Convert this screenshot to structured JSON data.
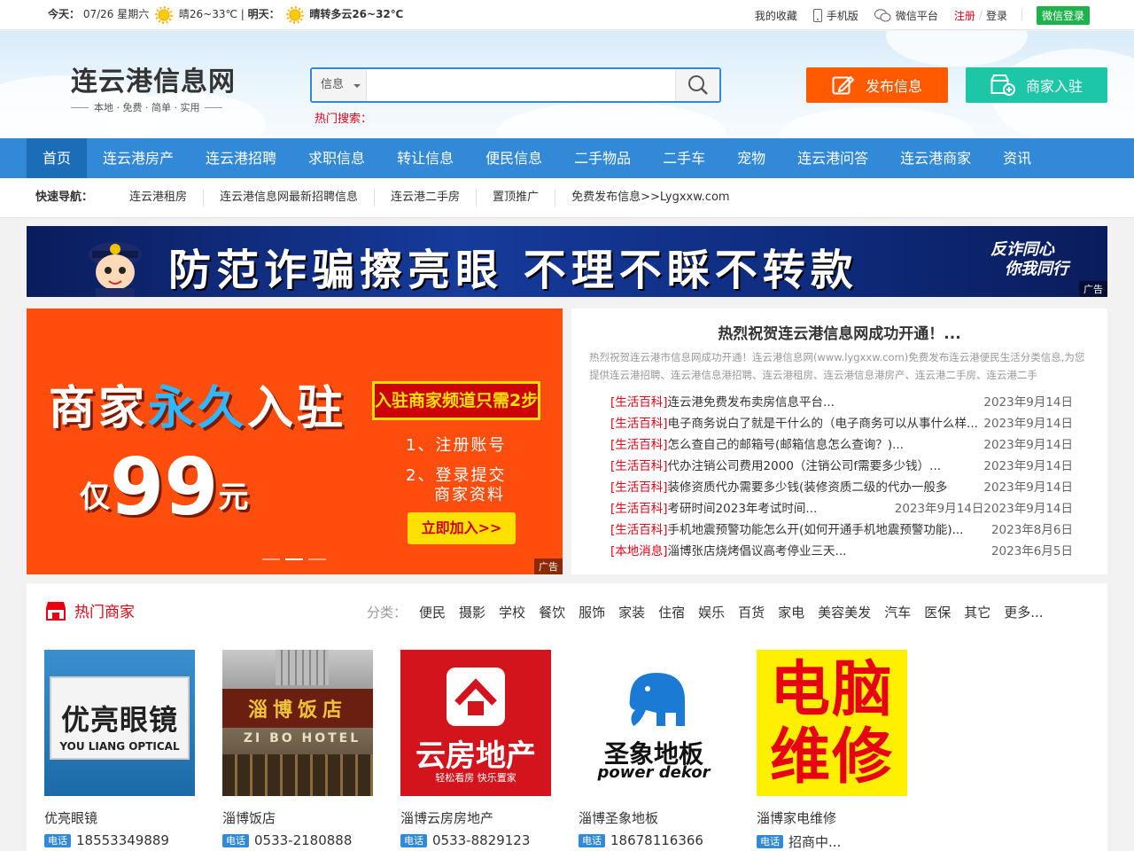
{
  "topbar": {
    "today_label": "今天：",
    "today_date": "07/26 星期六",
    "today_weather": "晴26~33℃ | ",
    "tomorrow_label": "明天：",
    "tomorrow_weather": "晴转多云26~32℃",
    "favorites": "我的收藏",
    "mobile": "手机版",
    "wechat_platform": "微信平台",
    "register": "注册",
    "login": "登录",
    "wechat_login": "微信登录"
  },
  "header": {
    "logo_title": "连云港信息网",
    "logo_slogan": "本地 · 免费 · 简单 · 实用",
    "search_type": "信息",
    "search_value": "",
    "hot_search_label": "热门搜索：",
    "publish_button": "发布信息",
    "merchant_join_button": "商家入驻"
  },
  "nav": {
    "items": [
      "首页",
      "连云港房产",
      "连云港招聘",
      "求职信息",
      "转让信息",
      "便民信息",
      "二手物品",
      "二手车",
      "宠物",
      "连云港问答",
      "连云港商家",
      "资讯"
    ]
  },
  "quicknav": {
    "label": "快速导航：",
    "items": [
      "连云港租房",
      "连云港信息网最新招聘信息",
      "连云港二手房",
      "置顶推广",
      "免费发布信息>>Lygxxw.com"
    ]
  },
  "banner": {
    "text": "防范诈骗擦亮眼  不理不睬不转款",
    "badge_line1": "反诈同心",
    "badge_line2": "你我同行",
    "ad_tag": "广告"
  },
  "big_ad": {
    "line1_a": "商家",
    "line1_b": "永久",
    "line1_c": "入驻",
    "line2_a": "仅",
    "line2_b": "99",
    "line2_c": "元",
    "box": "入驻商家频道只需2步",
    "step1": "1、注册账号",
    "step2a": "2、登录提交",
    "step2b": "商家资料",
    "join": "立即加入>>",
    "ad_tag": "广告"
  },
  "news": {
    "headline": "热烈祝贺连云港信息网成功开通！...",
    "intro": "热烈祝贺连云港市信息网成功开通！连云港信息网(www.lygxxw.com)免费发布连云港便民生活分类信息,为您提供连云港招聘、连云港信息港招聘、连云港租房、连云港信息港房产、连云港二手房、连云港二手",
    "items": [
      {
        "cat": "[生活百科]",
        "title": "连云港免费发布卖房信息平台...",
        "date": "2023年9月14日"
      },
      {
        "cat": "[生活百科]",
        "title": "电子商务说白了就是干什么的（电子商务可以从事什么样...",
        "date": "2023年9月14日"
      },
      {
        "cat": "[生活百科]",
        "title": "怎么查自己的邮箱号(邮箱信息怎么查询？)...",
        "date": "2023年9月14日"
      },
      {
        "cat": "[生活百科]",
        "title": "代办注销公司费用2000（注销公司f需要多少钱）...",
        "date": "2023年9月14日"
      },
      {
        "cat": "[生活百科]",
        "title": "装修资质代办需要多少钱(装修资质二级的代办一般多",
        "date": "2023年9月14日"
      },
      {
        "cat": "[生活百科]",
        "title": "考研时间2023年考试时间...",
        "date": "2023年9月14日2023年9月14日"
      },
      {
        "cat": "[生活百科]",
        "title": "手机地震预警功能怎么开(如何开通手机地震预警功能)...",
        "date": "2023年8月6日"
      },
      {
        "cat": "[本地消息]",
        "title": "淄博张店烧烤倡议高考停业三天...",
        "date": "2023年6月5日"
      }
    ]
  },
  "merchants": {
    "title": "热门商家",
    "category_label": "分类：",
    "categories": [
      "便民",
      "摄影",
      "学校",
      "餐饮",
      "服饰",
      "家装",
      "住宿",
      "娱乐",
      "百货",
      "家电",
      "美容美发",
      "汽车",
      "医保",
      "其它",
      "更多..."
    ],
    "tel_tag": "电话",
    "cards": [
      {
        "name": "优亮眼镜",
        "tel": "18553349889",
        "img_cn": "优亮眼镜",
        "img_en": "YOU LIANG OPTICAL"
      },
      {
        "name": "淄博饭店",
        "tel": "0533-2180888",
        "img_cn": "淄博饭店",
        "img_en": "ZI BO HOTEL"
      },
      {
        "name": "淄博云房房地产",
        "tel": "0533-8829123",
        "img_cn": "云房地产",
        "img_en": "轻松看房 快乐置家"
      },
      {
        "name": "淄博圣象地板",
        "tel": "18678116366",
        "img_cn": "圣象地板",
        "img_en": "power dekor"
      },
      {
        "name": "淄博家电维修",
        "tel": "招商中...",
        "img_cn": "电脑维修",
        "img_en": ""
      }
    ]
  },
  "colors": {
    "nav_blue": "#3189d8",
    "nav_active": "#1b6db8",
    "accent_red": "#e60012",
    "publish_orange": "#ff5a00",
    "join_teal": "#1ec6a8",
    "wechat_green": "#1fb14b"
  }
}
